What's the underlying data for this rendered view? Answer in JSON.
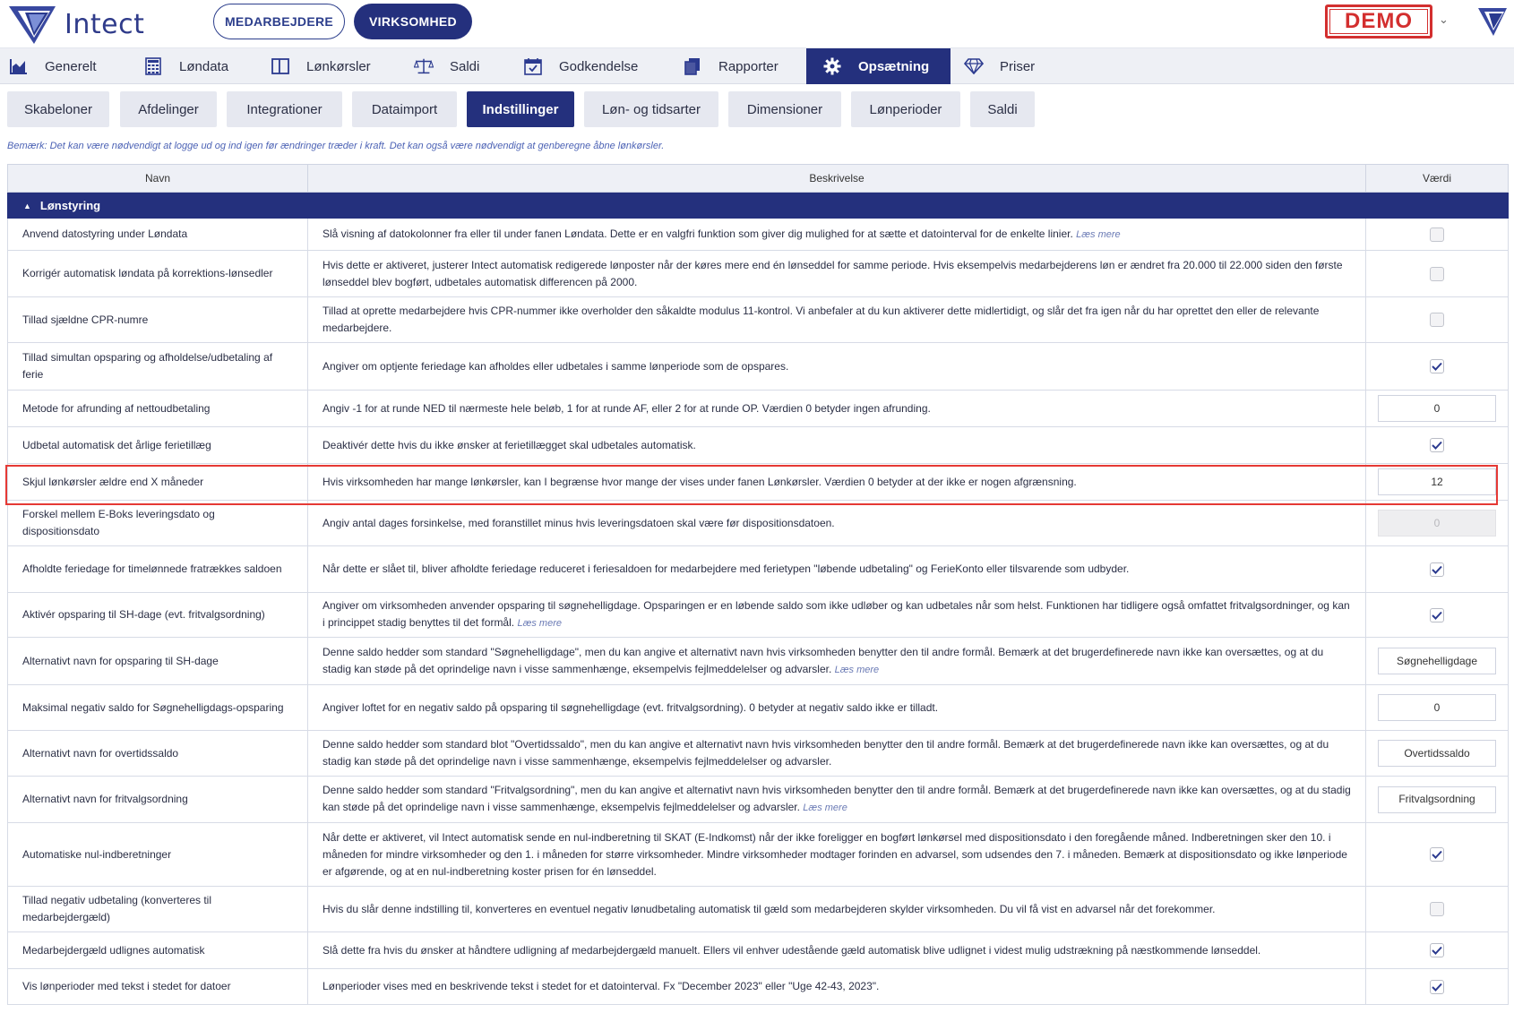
{
  "header": {
    "brand": "Intect",
    "switch_employees": "MEDARBEJDERE",
    "switch_company": "VIRKSOMHED",
    "demo_badge": "DEMO"
  },
  "main_nav": [
    {
      "label": "Generelt",
      "icon": "chart-icon",
      "active": false
    },
    {
      "label": "Løndata",
      "icon": "calculator-icon",
      "active": false
    },
    {
      "label": "Lønkørsler",
      "icon": "columns-icon",
      "active": false
    },
    {
      "label": "Saldi",
      "icon": "scale-icon",
      "active": false
    },
    {
      "label": "Godkendelse",
      "icon": "calendar-check-icon",
      "active": false
    },
    {
      "label": "Rapporter",
      "icon": "documents-icon",
      "active": false
    },
    {
      "label": "Opsætning",
      "icon": "gear-icon",
      "active": true
    },
    {
      "label": "Priser",
      "icon": "diamond-icon",
      "active": false
    }
  ],
  "sub_tabs": [
    {
      "label": "Skabeloner",
      "active": false
    },
    {
      "label": "Afdelinger",
      "active": false
    },
    {
      "label": "Integrationer",
      "active": false
    },
    {
      "label": "Dataimport",
      "active": false
    },
    {
      "label": "Indstillinger",
      "active": true
    },
    {
      "label": "Løn- og tidsarter",
      "active": false
    },
    {
      "label": "Dimensioner",
      "active": false
    },
    {
      "label": "Lønperioder",
      "active": false
    },
    {
      "label": "Saldi",
      "active": false
    }
  ],
  "note": "Bemærk: Det kan være nødvendigt at logge ud og ind igen før ændringer træder i kraft. Det kan også være nødvendigt at genberegne åbne lønkørsler.",
  "table": {
    "columns": {
      "name": "Navn",
      "description": "Beskrivelse",
      "value": "Værdi"
    },
    "group": "Lønstyring",
    "read_more": "Læs mere",
    "rows": [
      {
        "name": "Anvend datostyring under Løndata",
        "desc": "Slå visning af datokolonner fra eller til under fanen Løndata. Dette er en valgfri funktion som giver dig mulighed for at sætte et datointerval for de enkelte linier.",
        "more": "Læs mere",
        "type": "checkbox",
        "checked": false
      },
      {
        "name": "Korrigér automatisk løndata på korrektions-lønsedler",
        "desc": "Hvis dette er aktiveret, justerer Intect automatisk redigerede lønposter når der køres mere end én lønseddel for samme periode. Hvis eksempelvis medarbejderens løn er ændret fra 20.000 til 22.000 siden den første lønseddel blev bogført, udbetales automatisk differencen på 2000.",
        "type": "checkbox",
        "checked": false
      },
      {
        "name": "Tillad sjældne CPR-numre",
        "desc": "Tillad at oprette medarbejdere hvis CPR-nummer ikke overholder den såkaldte modulus 11-kontrol. Vi anbefaler at du kun aktiverer dette midlertidigt, og slår det fra igen når du har oprettet den eller de relevante medarbejdere.",
        "type": "checkbox",
        "checked": false
      },
      {
        "name": "Tillad simultan opsparing og afholdelse/udbetaling af ferie",
        "desc": "Angiver om optjente feriedage kan afholdes eller udbetales i samme lønperiode som de opspares.",
        "type": "checkbox",
        "checked": true
      },
      {
        "name": "Metode for afrunding af nettoudbetaling",
        "desc": "Angiv -1 for at runde NED til nærmeste hele beløb, 1 for at runde AF, eller 2 for at runde OP. Værdien 0 betyder ingen afrunding.",
        "type": "input",
        "value": "0"
      },
      {
        "name": "Udbetal automatisk det årlige ferietillæg",
        "desc": "Deaktivér dette hvis du ikke ønsker at ferietillægget skal udbetales automatisk.",
        "type": "checkbox",
        "checked": true
      },
      {
        "name": "Skjul lønkørsler ældre end X måneder",
        "desc": "Hvis virksomheden har mange lønkørsler, kan I begrænse hvor mange der vises under fanen Lønkørsler. Værdien 0 betyder at der ikke er nogen afgrænsning.",
        "type": "input",
        "value": "12"
      },
      {
        "name": "Forskel mellem E-Boks leveringsdato og dispositionsdato",
        "desc": "Angiv antal dages forsinkelse, med foranstillet minus hvis leveringsdatoen skal være før dispositionsdatoen.",
        "type": "input-disabled",
        "value": "0"
      },
      {
        "name": "Afholdte feriedage for timelønnede fratrækkes saldoen",
        "desc": "Når dette er slået til, bliver afholdte feriedage reduceret i feriesaldoen for medarbejdere med ferietypen \"løbende udbetaling\" og FerieKonto eller tilsvarende som udbyder.",
        "type": "checkbox",
        "checked": true
      },
      {
        "name": "Aktivér opsparing til SH-dage (evt. fritvalgsordning)",
        "desc": "Angiver om virksomheden anvender opsparing til søgnehelligdage. Opsparingen er en løbende saldo som ikke udløber og kan udbetales når som helst. Funktionen har tidligere også omfattet fritvalgsordninger, og kan i princippet stadig benyttes til det formål.",
        "more": "Læs mere",
        "type": "checkbox",
        "checked": true
      },
      {
        "name": "Alternativt navn for opsparing til SH-dage",
        "desc": "Denne saldo hedder som standard \"Søgnehelligdage\", men du kan angive et alternativt navn hvis virksomheden benytter den til andre formål. Bemærk at det brugerdefinerede navn ikke kan oversættes, og at du stadig kan støde på det oprindelige navn i visse sammenhænge, eksempelvis fejlmeddelelser og advarsler.",
        "more": "Læs mere",
        "type": "input",
        "value": "Søgnehelligdage"
      },
      {
        "name": "Maksimal negativ saldo for Søgnehelligdags-opsparing",
        "desc": "Angiver loftet for en negativ saldo på opsparing til søgnehelligdage (evt. fritvalgsordning). 0 betyder at negativ saldo ikke er tilladt.",
        "type": "input",
        "value": "0"
      },
      {
        "name": "Alternativt navn for overtidssaldo",
        "desc": "Denne saldo hedder som standard blot \"Overtidssaldo\", men du kan angive et alternativt navn hvis virksomheden benytter den til andre formål. Bemærk at det brugerdefinerede navn ikke kan oversættes, og at du stadig kan støde på det oprindelige navn i visse sammenhænge, eksempelvis fejlmeddelelser og advarsler.",
        "type": "input",
        "value": "Overtidssaldo"
      },
      {
        "name": "Alternativt navn for fritvalgsordning",
        "desc": "Denne saldo hedder som standard \"Fritvalgsordning\", men du kan angive et alternativt navn hvis virksomheden benytter den til andre formål. Bemærk at det brugerdefinerede navn ikke kan oversættes, og at du stadig kan støde på det oprindelige navn i visse sammenhænge, eksempelvis fejlmeddelelser og advarsler.",
        "more": "Læs mere",
        "type": "input",
        "value": "Fritvalgsordning"
      },
      {
        "name": "Automatiske nul-indberetninger",
        "desc": "Når dette er aktiveret, vil Intect automatisk sende en nul-indberetning til SKAT (E-Indkomst) når der ikke foreligger en bogført lønkørsel med dispositionsdato i den foregående måned. Indberetningen sker den 10. i måneden for mindre virksomheder og den 1. i måneden for større virksomheder. Mindre virksomheder modtager forinden en advarsel, som udsendes den 7. i måneden. Bemærk at dispositionsdato og ikke lønperiode er afgørende, og at en nul-indberetning koster prisen for én lønseddel.",
        "type": "checkbox",
        "checked": true
      },
      {
        "name": "Tillad negativ udbetaling (konverteres til medarbejdergæld)",
        "desc": "Hvis du slår denne indstilling til, konverteres en eventuel negativ lønudbetaling automatisk til gæld som medarbejderen skylder virksomheden. Du vil få vist en advarsel når det forekommer.",
        "type": "checkbox",
        "checked": false
      },
      {
        "name": "Medarbejdergæld udlignes automatisk",
        "desc": "Slå dette fra hvis du ønsker at håndtere udligning af medarbejdergæld manuelt. Ellers vil enhver udestående gæld automatisk blive udlignet i videst mulig udstrækning på næstkommende lønseddel.",
        "type": "checkbox",
        "checked": true
      },
      {
        "name": "Vis lønperioder med tekst i stedet for datoer",
        "desc": "Lønperioder vises med en beskrivende tekst i stedet for et datointerval. Fx \"December 2023\" eller \"Uge 42-43, 2023\".",
        "type": "checkbox",
        "checked": true
      }
    ]
  },
  "colors": {
    "primary": "#24307d",
    "highlight": "#e53935",
    "demo": "#d32f2f"
  }
}
